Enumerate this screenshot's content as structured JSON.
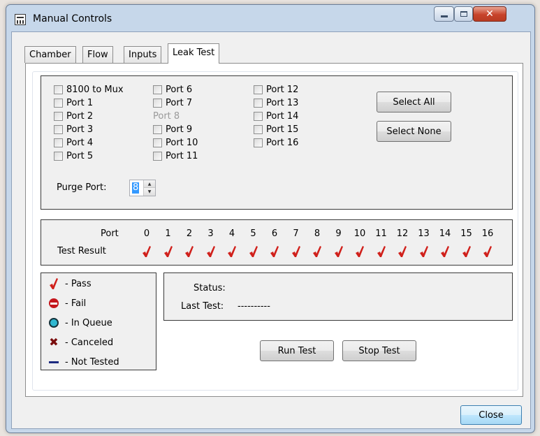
{
  "window": {
    "title": "Manual Controls"
  },
  "tabs": [
    "Chamber",
    "Flow",
    "Inputs",
    "Leak Test"
  ],
  "active_tab": "Leak Test",
  "ports": {
    "col1": [
      {
        "label": "8100 to Mux",
        "enabled": true
      },
      {
        "label": "Port 1",
        "enabled": true
      },
      {
        "label": "Port 2",
        "enabled": true
      },
      {
        "label": "Port 3",
        "enabled": true
      },
      {
        "label": "Port 4",
        "enabled": true
      },
      {
        "label": "Port 5",
        "enabled": true
      }
    ],
    "col2": [
      {
        "label": "Port 6",
        "enabled": true
      },
      {
        "label": "Port 7",
        "enabled": true
      },
      {
        "label": "Port 8",
        "enabled": false
      },
      {
        "label": "Port 9",
        "enabled": true
      },
      {
        "label": "Port 10",
        "enabled": true
      },
      {
        "label": "Port 11",
        "enabled": true
      }
    ],
    "col3": [
      {
        "label": "Port 12",
        "enabled": true
      },
      {
        "label": "Port 13",
        "enabled": true
      },
      {
        "label": "Port 14",
        "enabled": true
      },
      {
        "label": "Port 15",
        "enabled": true
      },
      {
        "label": "Port 16",
        "enabled": true
      }
    ]
  },
  "buttons": {
    "select_all": "Select All",
    "select_none": "Select None",
    "run_test": "Run Test",
    "stop_test": "Stop Test",
    "close": "Close"
  },
  "purge_port": {
    "label": "Purge Port:",
    "value": "8"
  },
  "results": {
    "port_label": "Port",
    "result_label": "Test Result",
    "ports": [
      "0",
      "1",
      "2",
      "3",
      "4",
      "5",
      "6",
      "7",
      "8",
      "9",
      "10",
      "11",
      "12",
      "13",
      "14",
      "15",
      "16"
    ],
    "values": [
      "pass",
      "pass",
      "pass",
      "pass",
      "pass",
      "pass",
      "pass",
      "pass",
      "pass",
      "pass",
      "pass",
      "pass",
      "pass",
      "pass",
      "pass",
      "pass",
      "pass"
    ]
  },
  "legend": [
    {
      "symbol": "check-icon",
      "label": "- Pass"
    },
    {
      "symbol": "fail-icon",
      "label": "- Fail"
    },
    {
      "symbol": "queue-icon",
      "label": "- In Queue"
    },
    {
      "symbol": "cancel-icon",
      "label": "- Canceled"
    },
    {
      "symbol": "not-tested-icon",
      "label": "- Not Tested"
    }
  ],
  "status": {
    "status_label": "Status:",
    "status_value": "",
    "last_test_label": "Last Test:",
    "last_test_value": "----------"
  },
  "colors": {
    "pass": "#d0201b",
    "fail": "#c4161c",
    "queue": "#2fb8d1",
    "not_tested": "#1d2b80",
    "close_button": "#c7432a"
  }
}
